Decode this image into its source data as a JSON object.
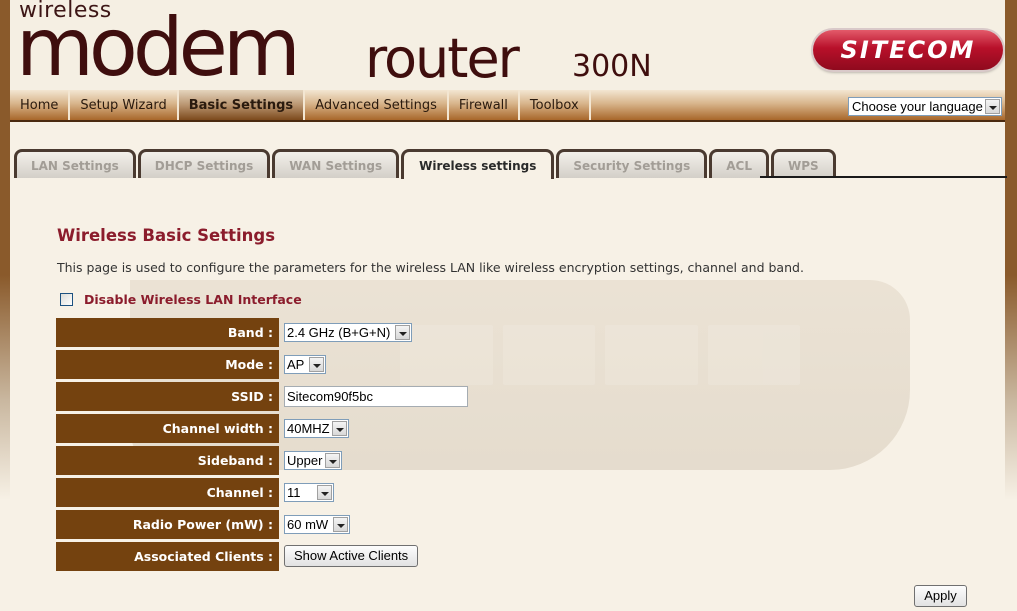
{
  "header": {
    "logo_small": "wireless",
    "logo_big": "modem",
    "logo_mid": "router",
    "logo_model": "300N",
    "brand": "SITECOM"
  },
  "nav": {
    "items": [
      {
        "label": "Home",
        "active": false
      },
      {
        "label": "Setup Wizard",
        "active": false
      },
      {
        "label": "Basic Settings",
        "active": true
      },
      {
        "label": "Advanced Settings",
        "active": false
      },
      {
        "label": "Firewall",
        "active": false
      },
      {
        "label": "Toolbox",
        "active": false
      }
    ],
    "language_select": "Choose your language"
  },
  "subtabs": [
    {
      "label": "LAN Settings",
      "active": false
    },
    {
      "label": "DHCP Settings",
      "active": false
    },
    {
      "label": "WAN Settings",
      "active": false
    },
    {
      "label": "Wireless settings",
      "active": true
    },
    {
      "label": "Security Settings",
      "active": false
    },
    {
      "label": "ACL",
      "active": false
    },
    {
      "label": "WPS",
      "active": false
    }
  ],
  "page": {
    "title": "Wireless Basic Settings",
    "description": "This page is used to configure the parameters for the wireless LAN like wireless encryption settings, channel and band.",
    "disable_label": "Disable Wireless LAN Interface",
    "disable_checked": false
  },
  "form": {
    "band": {
      "label": "Band :",
      "value": "2.4 GHz (B+G+N)"
    },
    "mode": {
      "label": "Mode :",
      "value": "AP"
    },
    "ssid": {
      "label": "SSID :",
      "value": "Sitecom90f5bc"
    },
    "channel_width": {
      "label": "Channel width :",
      "value": "40MHZ"
    },
    "sideband": {
      "label": "Sideband :",
      "value": "Upper"
    },
    "channel": {
      "label": "Channel :",
      "value": "11"
    },
    "radio_power": {
      "label": "Radio Power (mW) :",
      "value": "60 mW"
    },
    "associated_clients": {
      "label": "Associated Clients :",
      "button": "Show Active Clients"
    }
  },
  "actions": {
    "apply": "Apply"
  }
}
